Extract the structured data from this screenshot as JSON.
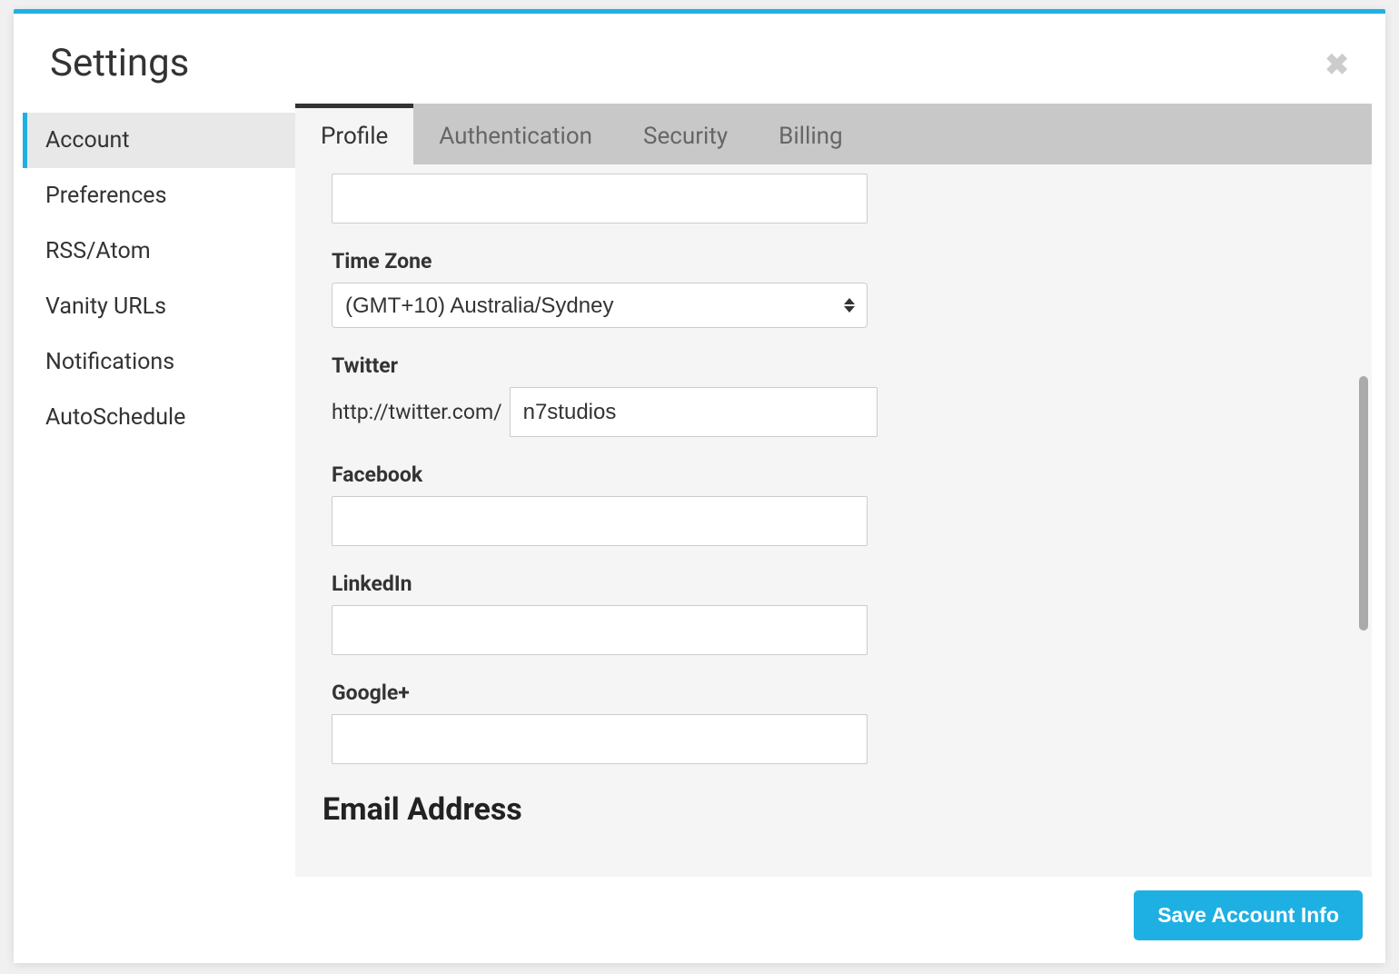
{
  "modal": {
    "title": "Settings"
  },
  "sidebar": {
    "items": [
      {
        "label": "Account",
        "active": true
      },
      {
        "label": "Preferences",
        "active": false
      },
      {
        "label": "RSS/Atom",
        "active": false
      },
      {
        "label": "Vanity URLs",
        "active": false
      },
      {
        "label": "Notifications",
        "active": false
      },
      {
        "label": "AutoSchedule",
        "active": false
      }
    ]
  },
  "tabs": [
    {
      "label": "Profile",
      "active": true
    },
    {
      "label": "Authentication",
      "active": false
    },
    {
      "label": "Security",
      "active": false
    },
    {
      "label": "Billing",
      "active": false
    }
  ],
  "form": {
    "top_input_value": "",
    "timezone_label": "Time Zone",
    "timezone_value": "(GMT+10) Australia/Sydney",
    "twitter_label": "Twitter",
    "twitter_prefix": "http://twitter.com/",
    "twitter_value": "n7studios",
    "facebook_label": "Facebook",
    "facebook_value": "",
    "linkedin_label": "LinkedIn",
    "linkedin_value": "",
    "google_label": "Google+",
    "google_value": "",
    "email_heading": "Email Address"
  },
  "footer": {
    "save_button": "Save Account Info"
  }
}
